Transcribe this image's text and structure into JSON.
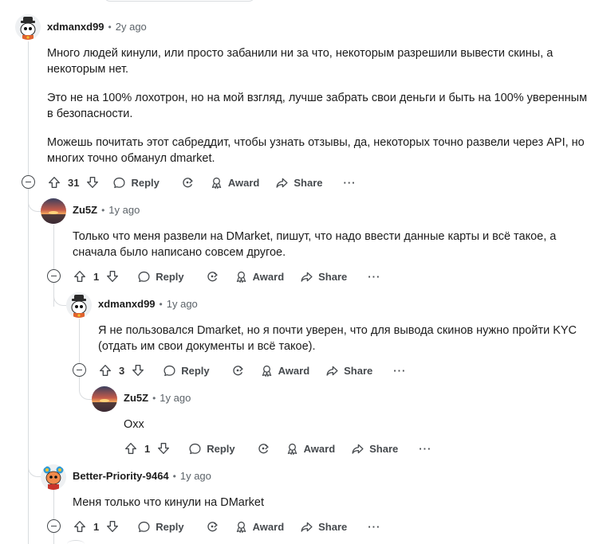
{
  "actions": {
    "reply": "Reply",
    "award": "Award",
    "share": "Share",
    "more": "···"
  },
  "comments": [
    {
      "author": "xdmanxd99",
      "time": "2y ago",
      "paragraphs": [
        "Много людей кинули, или просто забанили ни за что, некоторым разрешили вывести скины, а некоторым нет.",
        "Это не на 100% лохотрон, но на мой взгляд, лучше забрать свои деньги и быть на 100% уверенным в безопасности.",
        "Можешь почитать этот сабреддит, чтобы узнать отзывы, да, некоторых точно развели через API, но многих точно обманул dmarket."
      ],
      "votes": "31",
      "avatar_icon": "snoo-hat-avatar-icon"
    },
    {
      "author": "Zu5Z",
      "time": "1y ago",
      "paragraphs": [
        "Только что меня развели на DMarket, пишут, что надо ввести данные карты и всё такое, а сначала было написано совсем другое."
      ],
      "votes": "1",
      "avatar_icon": "sunset-avatar-icon"
    },
    {
      "author": "xdmanxd99",
      "time": "1y ago",
      "paragraphs": [
        "Я не пользовался Dmarket, но я почти уверен, что для вывода скинов нужно пройти KYC (отдать им свои документы и всё такое)."
      ],
      "votes": "3",
      "avatar_icon": "snoo-hat-avatar-icon"
    },
    {
      "author": "Zu5Z",
      "time": "1y ago",
      "paragraphs": [
        "Oxx"
      ],
      "votes": "1",
      "avatar_icon": "sunset-avatar-icon"
    },
    {
      "author": "Better-Priority-9464",
      "time": "1y ago",
      "paragraphs": [
        "Меня только что кинули на DMarket"
      ],
      "votes": "1",
      "avatar_icon": "snoo-bear-ears-avatar-icon"
    }
  ],
  "colors": {
    "thread_line": "#d9dcdf",
    "text": "#1c1c1c",
    "muted": "#5c6369",
    "action": "#45494d"
  }
}
